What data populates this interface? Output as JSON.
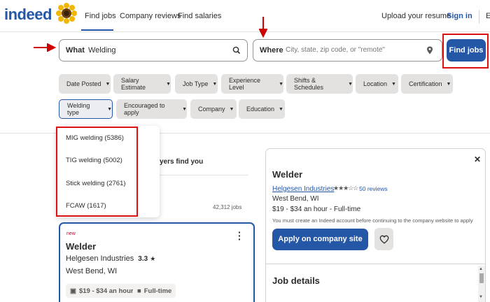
{
  "header": {
    "logo": "indeed",
    "nav": [
      "Find jobs",
      "Company reviews",
      "Find salaries"
    ],
    "upload": "Upload your resume",
    "signin": "Sign in",
    "edge": "E"
  },
  "search": {
    "what_label": "What",
    "what_value": "Welding",
    "where_label": "Where",
    "where_placeholder": "City, state, zip code, or \"remote\"",
    "find_button": "Find jobs"
  },
  "filters": {
    "row1": [
      "Date Posted",
      "Salary Estimate",
      "Job Type",
      "Experience Level",
      "Shifts & Schedules",
      "Location",
      "Certification"
    ],
    "row2": [
      "Welding type",
      "Encouraged to apply",
      "Company",
      "Education"
    ]
  },
  "welding_dropdown": [
    "MIG welding (5386)",
    "TIG welding (5002)",
    "Stick welding (2761)",
    "FCAW (1617)"
  ],
  "left": {
    "employers_text": "yers find you",
    "job_count": "42,312 jobs",
    "card": {
      "new": "new",
      "title": "Welder",
      "company": "Helgesen Industries",
      "rating": "3.3",
      "location": "West Bend, WI",
      "salary_tag": "$19 - $34 an hour",
      "type_tag": "Full-time"
    }
  },
  "panel": {
    "title": "Welder",
    "company": "Helgesen Industries",
    "reviews": "50 reviews",
    "location": "West Bend, WI",
    "salary": "$19 - $34 an hour  - Full-time",
    "note": "You must create an Indeed account before continuing to the company website to apply",
    "apply_button": "Apply on company site",
    "details_heading": "Job details"
  },
  "colors": {
    "brand": "#2557a7",
    "annotation": "#cc0000"
  }
}
